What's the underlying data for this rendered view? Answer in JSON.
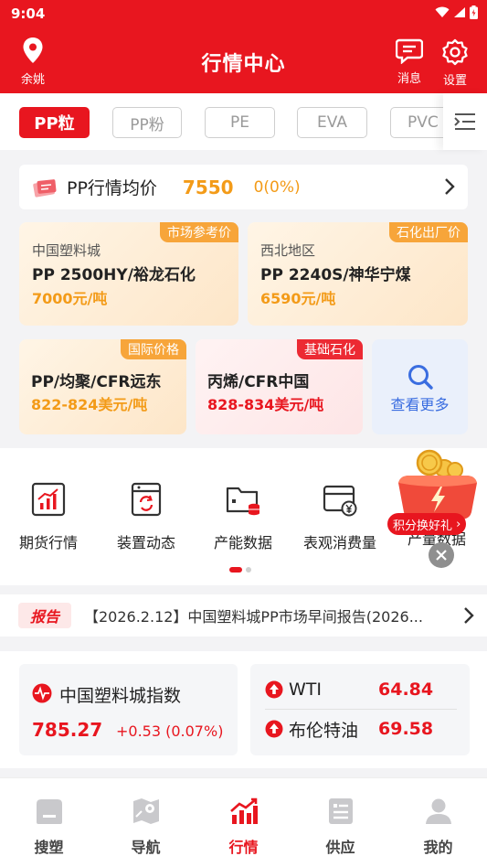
{
  "status_bar": {
    "time": "9:04"
  },
  "header": {
    "location": "余姚",
    "title": "行情中心",
    "messages_label": "消息",
    "settings_label": "设置"
  },
  "tabs": [
    {
      "label": "PP粒",
      "active": true
    },
    {
      "label": "PP粉",
      "active": false
    },
    {
      "label": "PE",
      "active": false
    },
    {
      "label": "EVA",
      "active": false
    },
    {
      "label": "PVC",
      "active": false
    }
  ],
  "avg_price": {
    "label": "PP行情均价",
    "value": "7550",
    "change": "0(0%)"
  },
  "price_cards": [
    {
      "tag": "市场参考价",
      "region": "中国塑料城",
      "name": "PP 2500HY/裕龙石化",
      "price": "7000元/吨"
    },
    {
      "tag": "石化出厂价",
      "region": "西北地区",
      "name": "PP 2240S/神华宁煤",
      "price": "6590元/吨"
    },
    {
      "tag": "国际价格",
      "name": "PP/均聚/CFR远东",
      "price": "822-824美元/吨"
    },
    {
      "tag": "基础石化",
      "name": "丙烯/CFR中国",
      "price": "828-834美元/吨"
    }
  ],
  "see_more_label": "查看更多",
  "shortcuts": [
    {
      "label": "期货行情",
      "icon": "futures-chart-icon"
    },
    {
      "label": "装置动态",
      "icon": "device-refresh-icon"
    },
    {
      "label": "产能数据",
      "icon": "capacity-folder-icon"
    },
    {
      "label": "表观消费量",
      "icon": "consumption-card-icon"
    },
    {
      "label": "产量数据",
      "icon": "output-data-icon"
    }
  ],
  "promo": {
    "label": "积分换好礼"
  },
  "report": {
    "badge": "报告",
    "text": "【2026.2.12】中国塑料城PP市场早间报告(2026..."
  },
  "index": {
    "name": "中国塑料城指数",
    "value": "785.27",
    "change": "+0.53 (0.07%)",
    "oils": [
      {
        "name": "WTI",
        "value": "64.84"
      },
      {
        "name": "布伦特油",
        "value": "69.58"
      }
    ]
  },
  "bottom_nav": [
    {
      "label": "搜塑",
      "active": false,
      "icon": "home-icon"
    },
    {
      "label": "导航",
      "active": false,
      "icon": "map-icon"
    },
    {
      "label": "行情",
      "active": true,
      "icon": "trend-chart-icon"
    },
    {
      "label": "供应",
      "active": false,
      "icon": "supply-list-icon"
    },
    {
      "label": "我的",
      "active": false,
      "icon": "profile-icon"
    }
  ],
  "colors": {
    "brand_red": "#e8161f",
    "price_orange": "#f39b18",
    "link_blue": "#3a6de0"
  }
}
